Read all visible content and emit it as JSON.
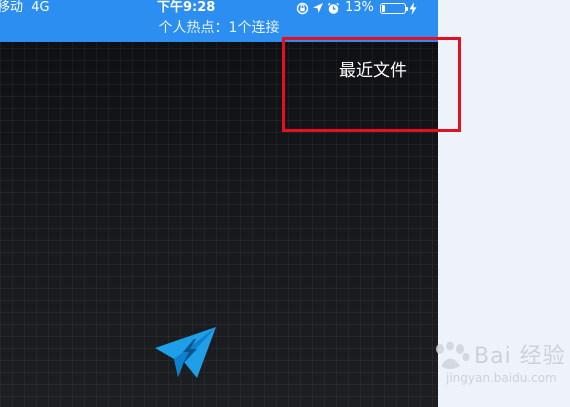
{
  "status_bar": {
    "carrier": "移动",
    "network": "4G",
    "time": "下午9:28",
    "battery_percent": "13%",
    "battery_level": 0.13,
    "icons": [
      "screen-lock-icon",
      "location-icon",
      "alarm-icon",
      "battery-icon",
      "charging-icon"
    ]
  },
  "hotspot": {
    "text": "个人热点：1个连接"
  },
  "toolbar": {
    "recent_files_label": "最近文件"
  },
  "app": {
    "logo_icon": "paper-plane-icon",
    "logo_color": "#1e9fe8"
  },
  "annotation": {
    "highlight_color": "#e3101f"
  },
  "watermark": {
    "text": "Bai  经验",
    "url": "jingyan.baidu.com"
  },
  "colors": {
    "status_bar_bg": "#2b8ef0",
    "screen_bg": "#101114",
    "page_bg": "#eef2f9"
  }
}
